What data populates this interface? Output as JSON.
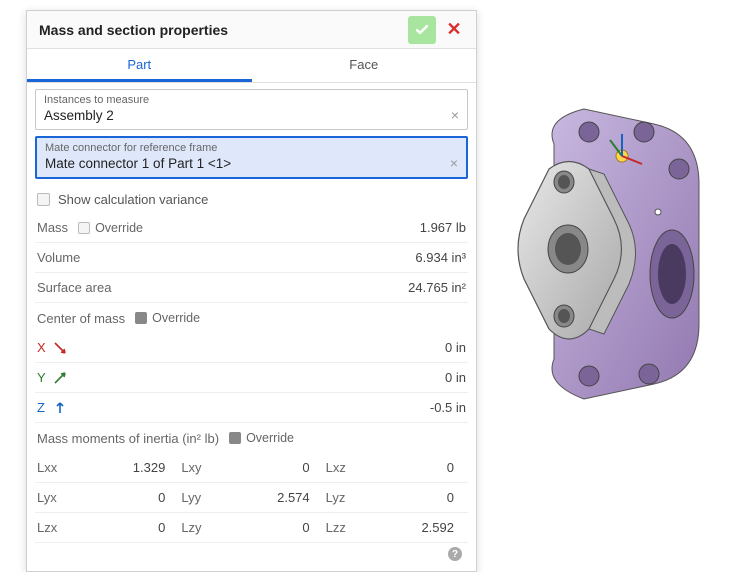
{
  "header": {
    "title": "Mass and section properties"
  },
  "tabs": {
    "part": "Part",
    "face": "Face"
  },
  "fields": {
    "instances_label": "Instances to measure",
    "instances_value": "Assembly 2",
    "mateframe_label": "Mate connector for reference frame",
    "mateframe_value": "Mate connector 1 of Part 1 <1>"
  },
  "show_variance_label": "Show calculation variance",
  "mass": {
    "label": "Mass",
    "override_label": "Override",
    "value": "1.967 lb"
  },
  "volume": {
    "label": "Volume",
    "value": "6.934 in³"
  },
  "surface_area": {
    "label": "Surface area",
    "value": "24.765 in²"
  },
  "center_of_mass": {
    "label": "Center of mass",
    "override_label": "Override"
  },
  "axes": {
    "x": {
      "name": "X",
      "value": "0 in",
      "color": "#c62828"
    },
    "y": {
      "name": "Y",
      "value": "0 in",
      "color": "#2e7d32"
    },
    "z": {
      "name": "Z",
      "value": "-0.5 in",
      "color": "#1565c0"
    }
  },
  "inertia": {
    "title": "Mass moments of inertia (in² lb)",
    "override_label": "Override",
    "cells": {
      "Lxx": "1.329",
      "Lxy": "0",
      "Lxz": "0",
      "Lyx": "0",
      "Lyy": "2.574",
      "Lyz": "0",
      "Lzx": "0",
      "Lzy": "0",
      "Lzz": "2.592"
    }
  }
}
